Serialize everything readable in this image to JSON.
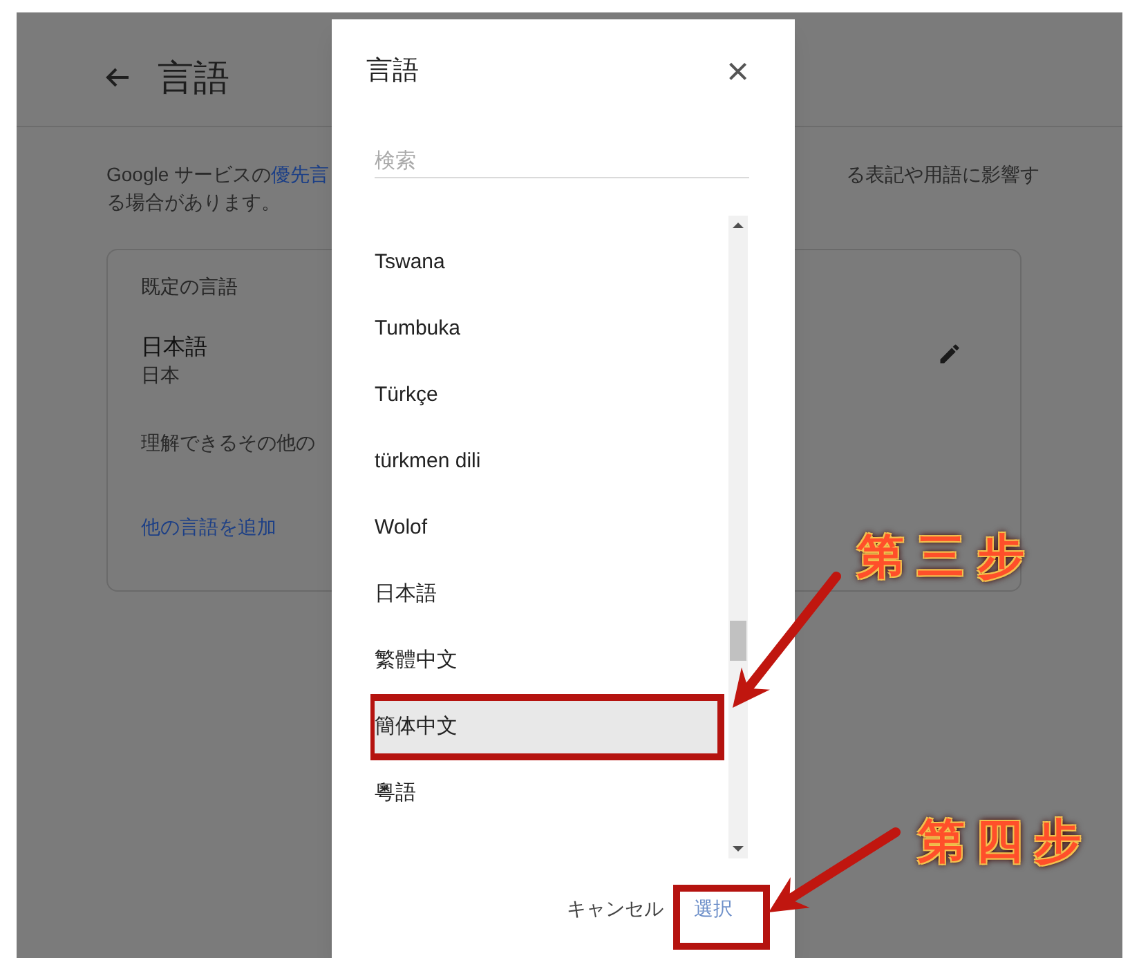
{
  "page": {
    "title": "言語",
    "description_start": "Google サービスの",
    "description_link": "優先言",
    "description_end": "る表記や用語に影響す",
    "description_line2": "る場合があります。"
  },
  "card": {
    "heading": "既定の言語",
    "language": "日本語",
    "region": "日本",
    "other_label": "理解できるその他の",
    "add_link": "他の言語を追加"
  },
  "dialog": {
    "title": "言語",
    "close": "×",
    "search": {
      "placeholder": "検索"
    },
    "items": [
      {
        "label": "Tswana",
        "selected": false
      },
      {
        "label": "Tumbuka",
        "selected": false
      },
      {
        "label": "Türkçe",
        "selected": false
      },
      {
        "label": "türkmen dili",
        "selected": false
      },
      {
        "label": "Wolof",
        "selected": false
      },
      {
        "label": "日本語",
        "selected": false
      },
      {
        "label": "繁體中文",
        "selected": false
      },
      {
        "label": "簡体中文",
        "selected": true
      },
      {
        "label": "粵語",
        "selected": false
      }
    ],
    "buttons": [
      {
        "label": "キャンセル",
        "kind": "cancel"
      },
      {
        "label": "選択",
        "kind": "primary"
      }
    ]
  },
  "annotations": [
    {
      "label": "第 三 步"
    },
    {
      "label": "第四步"
    }
  ]
}
